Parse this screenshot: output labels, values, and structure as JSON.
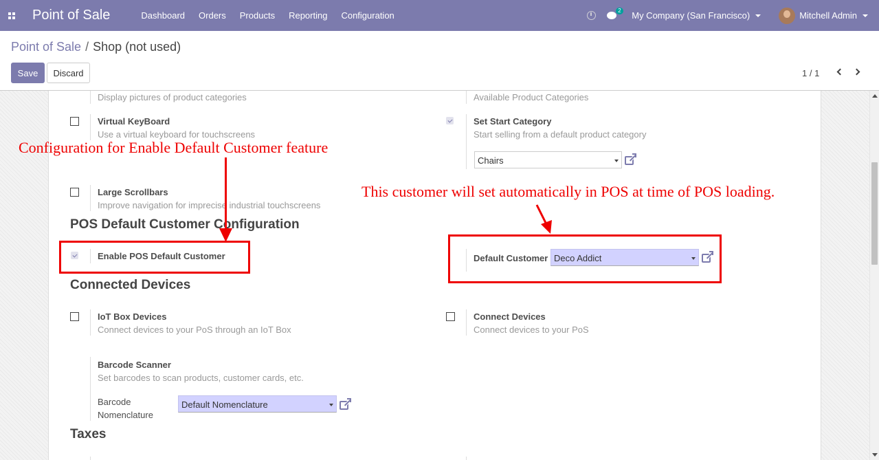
{
  "navbar": {
    "app_name": "Point of Sale",
    "menu": [
      "Dashboard",
      "Orders",
      "Products",
      "Reporting",
      "Configuration"
    ],
    "chat_count": "2",
    "company": "My Company (San Francisco)",
    "user": "Mitchell Admin"
  },
  "breadcrumb": {
    "parent": "Point of Sale",
    "separator": "/",
    "current": "Shop (not used)"
  },
  "actions": {
    "save": "Save",
    "discard": "Discard"
  },
  "pager": {
    "value": "1 / 1"
  },
  "settings": {
    "categories_desc": "Display pictures of product categories",
    "available_categories_desc": "Available Product Categories",
    "virtual_keyboard": {
      "title": "Virtual KeyBoard",
      "desc": "Use a virtual keyboard for touchscreens",
      "checked": false
    },
    "start_category": {
      "title": "Set Start Category",
      "desc": "Start selling from a default product category",
      "value": "Chairs",
      "checked": true
    },
    "large_scrollbars": {
      "title": "Large Scrollbars",
      "desc": "Improve navigation for imprecise industrial touchscreens",
      "checked": false
    },
    "default_customer_section": "POS Default Customer Configuration",
    "enable_default_customer": {
      "title": "Enable POS Default Customer",
      "checked": true
    },
    "default_customer": {
      "label": "Default Customer",
      "value": "Deco Addict"
    },
    "connected_devices_section": "Connected Devices",
    "iot_box": {
      "title": "IoT Box Devices",
      "desc": "Connect devices to your PoS through an IoT Box",
      "checked": false
    },
    "connect_devices": {
      "title": "Connect Devices",
      "desc": "Connect devices to your PoS",
      "checked": false
    },
    "barcode_scanner": {
      "title": "Barcode Scanner",
      "desc": "Set barcodes to scan products, customer cards, etc.",
      "nomenclature_label_1": "Barcode",
      "nomenclature_label_2": "Nomenclature",
      "nomenclature_value": "Default Nomenclature"
    },
    "taxes_section": "Taxes"
  },
  "annotations": {
    "left": "Configuration for Enable Default Customer feature",
    "right": "This customer will set automatically in POS at time of POS loading."
  },
  "colors": {
    "brand": "#7c7bad",
    "annotation": "#ee0000",
    "required_field": "#d2d2ff"
  }
}
